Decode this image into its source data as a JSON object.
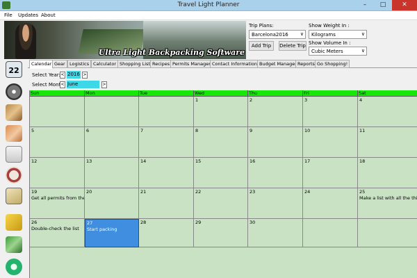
{
  "window": {
    "title": "Travel Light Planner"
  },
  "menu": [
    "File",
    "Updates",
    "About"
  ],
  "banner": {
    "logo_text": "Ultra Light Backpacking Software"
  },
  "trip": {
    "plans_label": "Trip Plans:",
    "plan_value": "Barcelona2016",
    "add_label": "Add Trip",
    "delete_label": "Delete Trip"
  },
  "settings": {
    "weight_label": "Show Weight In :",
    "weight_value": "Kilograms",
    "volume_label": "Show Volume In :",
    "volume_value": "Cubic Meters"
  },
  "tabs": [
    "Calendar",
    "Gear",
    "Logistics",
    "Calculator",
    "Shopping List",
    "Recipes",
    "Permits Manager",
    "Contact Information",
    "Budget Manager",
    "Reports",
    "Go Shopping!"
  ],
  "calendar": {
    "year_label": "Select Year:",
    "year_value": "2016",
    "month_label": "Select Month:",
    "month_value": "June",
    "prev": "<",
    "next": ">",
    "days": [
      "Sun",
      "Mon",
      "Tue",
      "Wed",
      "Thu",
      "Fri",
      "Sat"
    ],
    "weeks": [
      [
        {
          "n": "",
          "note": ""
        },
        {
          "n": "",
          "note": ""
        },
        {
          "n": "",
          "note": ""
        },
        {
          "n": "1",
          "note": ""
        },
        {
          "n": "2",
          "note": ""
        },
        {
          "n": "3",
          "note": ""
        },
        {
          "n": "4",
          "note": ""
        }
      ],
      [
        {
          "n": "5",
          "note": ""
        },
        {
          "n": "6",
          "note": ""
        },
        {
          "n": "7",
          "note": ""
        },
        {
          "n": "8",
          "note": ""
        },
        {
          "n": "9",
          "note": ""
        },
        {
          "n": "10",
          "note": ""
        },
        {
          "n": "11",
          "note": ""
        }
      ],
      [
        {
          "n": "12",
          "note": ""
        },
        {
          "n": "13",
          "note": ""
        },
        {
          "n": "14",
          "note": ""
        },
        {
          "n": "15",
          "note": ""
        },
        {
          "n": "16",
          "note": ""
        },
        {
          "n": "17",
          "note": ""
        },
        {
          "n": "18",
          "note": ""
        }
      ],
      [
        {
          "n": "19",
          "note": "Get all permits from the ve"
        },
        {
          "n": "20",
          "note": ""
        },
        {
          "n": "21",
          "note": ""
        },
        {
          "n": "22",
          "note": ""
        },
        {
          "n": "23",
          "note": ""
        },
        {
          "n": "24",
          "note": ""
        },
        {
          "n": "25",
          "note": "Make a list with all the thi"
        }
      ],
      [
        {
          "n": "26",
          "note": "Double-check the list"
        },
        {
          "n": "27",
          "note": "Start packing"
        },
        {
          "n": "28",
          "note": ""
        },
        {
          "n": "29",
          "note": ""
        },
        {
          "n": "30",
          "note": ""
        },
        {
          "n": "",
          "note": ""
        },
        {
          "n": "",
          "note": ""
        }
      ]
    ],
    "selected_day": "27"
  },
  "sidebar_icons": [
    "calendar-icon",
    "gear-icon",
    "map-icon",
    "calculator-icon",
    "shopping-cart-icon",
    "recipe-icon",
    "permit-icon",
    "contacts-icon",
    "budget-icon",
    "reports-icon"
  ],
  "colors": {
    "header_green": "#19e70a",
    "cell_green": "#c9e2c4",
    "selected_blue": "#3f8ee0"
  }
}
